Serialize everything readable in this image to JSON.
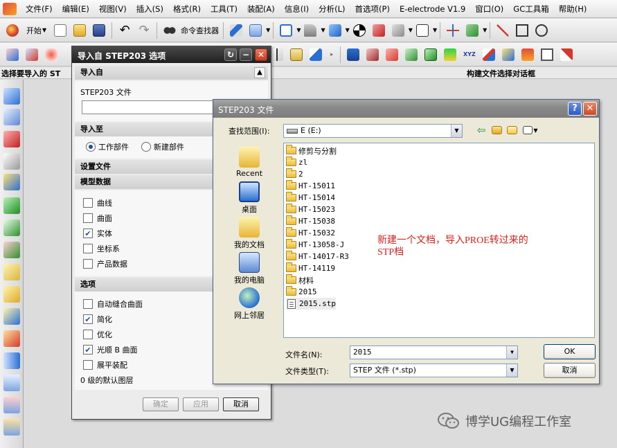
{
  "menubar": {
    "items": [
      "文件(F)",
      "编辑(E)",
      "视图(V)",
      "插入(S)",
      "格式(R)",
      "工具(T)",
      "装配(A)",
      "信息(I)",
      "分析(L)",
      "首选项(P)",
      "E-electrode V1.9",
      "窗口(O)",
      "GC工具箱",
      "帮助(H)"
    ]
  },
  "toolbar": {
    "start_label": "开始",
    "command_finder_label": "命令查找器"
  },
  "cue_line": {
    "left": "选择要导入的 ST",
    "right": "构建文件选择对话框"
  },
  "import_dialog": {
    "title": "导入自 STEP203 选项",
    "section_import_from": "导入自",
    "step_file_label": "STEP203 文件",
    "step_file_value": "",
    "section_import_to": "导入至",
    "radio_work_part": "工作部件",
    "radio_new_part": "新建部件",
    "section_settings_file": "设置文件",
    "section_model_data": "模型数据",
    "model_data": [
      {
        "label": "曲线",
        "checked": false
      },
      {
        "label": "曲面",
        "checked": false
      },
      {
        "label": "实体",
        "checked": true
      },
      {
        "label": "坐标系",
        "checked": false
      },
      {
        "label": "产品数据",
        "checked": false
      }
    ],
    "section_options": "选项",
    "options": [
      {
        "label": "自动缝合曲面",
        "checked": false
      },
      {
        "label": "简化",
        "checked": true
      },
      {
        "label": "优化",
        "checked": false
      },
      {
        "label": "光顺 B 曲面",
        "checked": true
      },
      {
        "label": "展平装配",
        "checked": false
      }
    ],
    "layer_text": "0 级的默认图层",
    "ok_label": "确定",
    "apply_label": "应用",
    "cancel_label": "取消"
  },
  "file_dialog": {
    "title": "STEP203 文件",
    "look_in_label": "查找范围(I):",
    "look_in_value": "E (E:)",
    "places": [
      "Recent",
      "桌面",
      "我的文档",
      "我的电脑",
      "网上邻居"
    ],
    "files": [
      {
        "name": "修剪与分割",
        "type": "folder"
      },
      {
        "name": "zl",
        "type": "folder"
      },
      {
        "name": "2",
        "type": "folder"
      },
      {
        "name": "HT-15011",
        "type": "folder"
      },
      {
        "name": "HT-15014",
        "type": "folder"
      },
      {
        "name": "HT-15023",
        "type": "folder"
      },
      {
        "name": "HT-15038",
        "type": "folder"
      },
      {
        "name": "HT-15032",
        "type": "folder"
      },
      {
        "name": "HT-13058-J",
        "type": "folder"
      },
      {
        "name": "HT-14017-R3",
        "type": "folder"
      },
      {
        "name": "HT-14119",
        "type": "folder"
      },
      {
        "name": "材料",
        "type": "folder"
      },
      {
        "name": "2015",
        "type": "folder"
      },
      {
        "name": "2015.stp",
        "type": "file"
      }
    ],
    "annotation": "新建一个文档，导入PROE转过来的STP档",
    "filename_label": "文件名(N):",
    "filename_value": "2015",
    "filetype_label": "文件类型(T):",
    "filetype_value": "STEP 文件 (*.stp)",
    "ok_label": "OK",
    "cancel_label": "取消"
  },
  "watermark": {
    "text": "博学UG编程工作室"
  },
  "colors": {
    "dialog_title_dark": "#1f1f1f",
    "check_blue": "#1b4fae",
    "annotation_red": "#e0201b",
    "folder_yellow": "#e9bc3d"
  }
}
